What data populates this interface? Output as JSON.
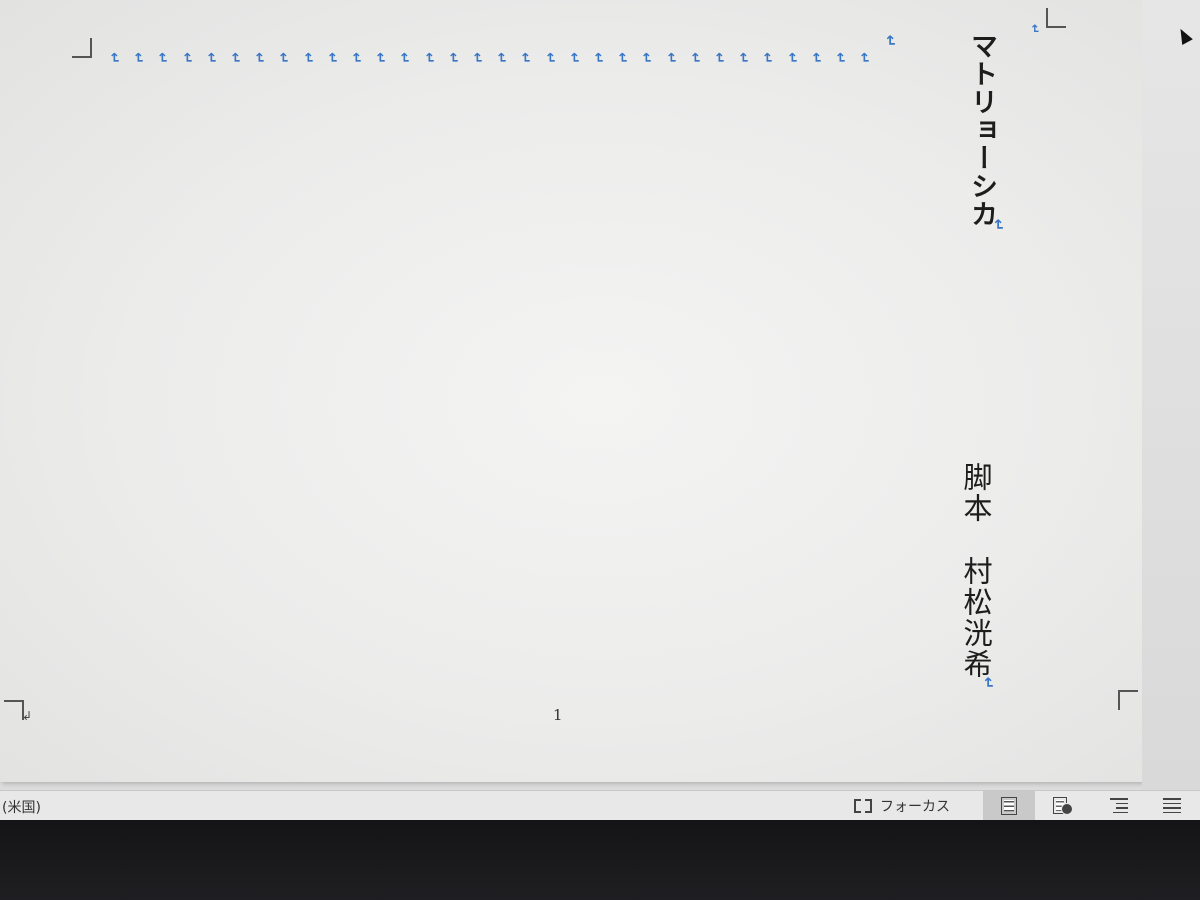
{
  "document": {
    "title": "マトリョーシカ",
    "author_label": "脚本",
    "author_name": "村松洸希",
    "page_number": "1",
    "paragraph_mark": "↵",
    "section_mark": "↲"
  },
  "statusbar": {
    "language": "(米国)",
    "focus_label": "フォーカス",
    "views": [
      {
        "name": "print-layout",
        "icon": "print-layout-icon",
        "active": true
      },
      {
        "name": "web-layout",
        "icon": "web-layout-icon",
        "active": false
      },
      {
        "name": "outline",
        "icon": "outline-icon",
        "active": false
      },
      {
        "name": "draft",
        "icon": "draft-icon",
        "active": false
      }
    ]
  },
  "colors": {
    "paragraph_mark": "#3a76c6",
    "text": "#1d1d1d",
    "status_bg": "#e8e8e8",
    "bezel": "#1a1a1c"
  }
}
